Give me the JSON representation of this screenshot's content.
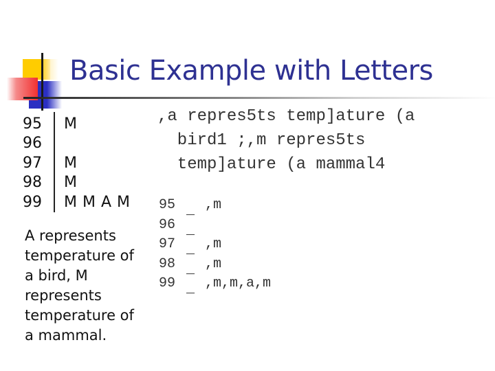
{
  "slide": {
    "title": "Basic Example with Letters",
    "accent_color": "#2E3192",
    "stem_leaf": {
      "rows": [
        {
          "stem": "95",
          "leaves": "M"
        },
        {
          "stem": "96",
          "leaves": ""
        },
        {
          "stem": "97",
          "leaves": "M"
        },
        {
          "stem": "98",
          "leaves": "M"
        },
        {
          "stem": "99",
          "leaves": "M M A M"
        }
      ]
    },
    "caption_lines": [
      "A represents",
      "temperature of",
      "a bird, M",
      "represents",
      "temperature of",
      "a mammal."
    ],
    "garbled_paragraph_lines": [
      ",a repres5ts temp]ature (a",
      "  bird1 ;,m repres5ts",
      "  temp]ature (a mammal4"
    ],
    "garbled_table": {
      "rows": [
        {
          "stem": "95",
          "sep": "_",
          "leaves": ",m"
        },
        {
          "stem": "96",
          "sep": "_",
          "leaves": ""
        },
        {
          "stem": "97",
          "sep": "_",
          "leaves": ",m"
        },
        {
          "stem": "98",
          "sep": "_",
          "leaves": ",m"
        },
        {
          "stem": "99",
          "sep": "_",
          "leaves": ",m,m,a,m"
        }
      ]
    }
  }
}
